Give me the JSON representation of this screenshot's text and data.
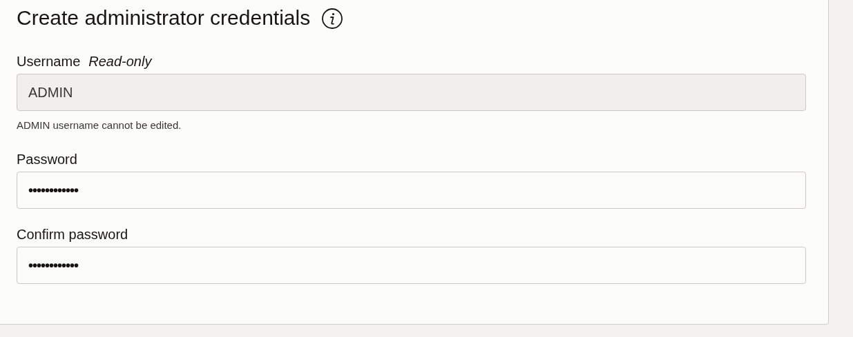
{
  "title": "Create administrator credentials",
  "fields": [
    {
      "label": "Username",
      "note": "Read-only",
      "value": "ADMIN",
      "read_only": true,
      "help": "ADMIN username cannot be edited."
    },
    {
      "label": "Password",
      "value": "••••••••••••",
      "read_only": false
    },
    {
      "label": "Confirm password",
      "value": "••••••••••••",
      "read_only": false
    }
  ]
}
